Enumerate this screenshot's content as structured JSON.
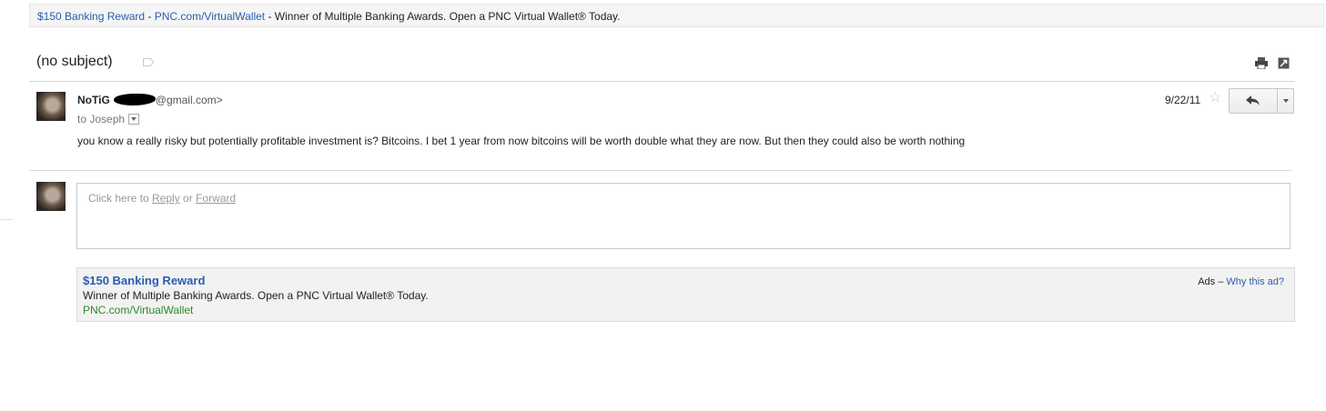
{
  "top_ad": {
    "title": "$150 Banking Reward",
    "separator1": " - ",
    "url": "PNC.com/VirtualWallet",
    "separator2": " - ",
    "description": "Winner of Multiple Banking Awards. Open a PNC Virtual Wallet® Today."
  },
  "thread": {
    "subject": "(no subject)"
  },
  "message": {
    "sender_name": "NoTiG",
    "sender_email_suffix": "@gmail.com>",
    "recipient_prefix": "to",
    "recipient": "Joseph",
    "date": "9/22/11",
    "body": "you know a really risky but potentially profitable investment is? Bitcoins.  I bet 1 year from now bitcoins will be worth double what they are now. But then they could also be worth nothing"
  },
  "reply_box": {
    "prefix": "Click here to ",
    "reply_link": "Reply",
    "middle": " or ",
    "forward_link": "Forward"
  },
  "bottom_ad": {
    "title": "$150 Banking Reward",
    "description": "Winner of Multiple Banking Awards. Open a PNC Virtual Wallet® Today.",
    "url": "PNC.com/VirtualWallet",
    "ads_label": "Ads – ",
    "why_link": "Why this ad?"
  },
  "icons": {
    "label": "label-icon",
    "print": "print-icon",
    "popout": "new-window-icon",
    "star": "star-icon",
    "reply": "reply-icon",
    "more": "chevron-down-icon"
  }
}
